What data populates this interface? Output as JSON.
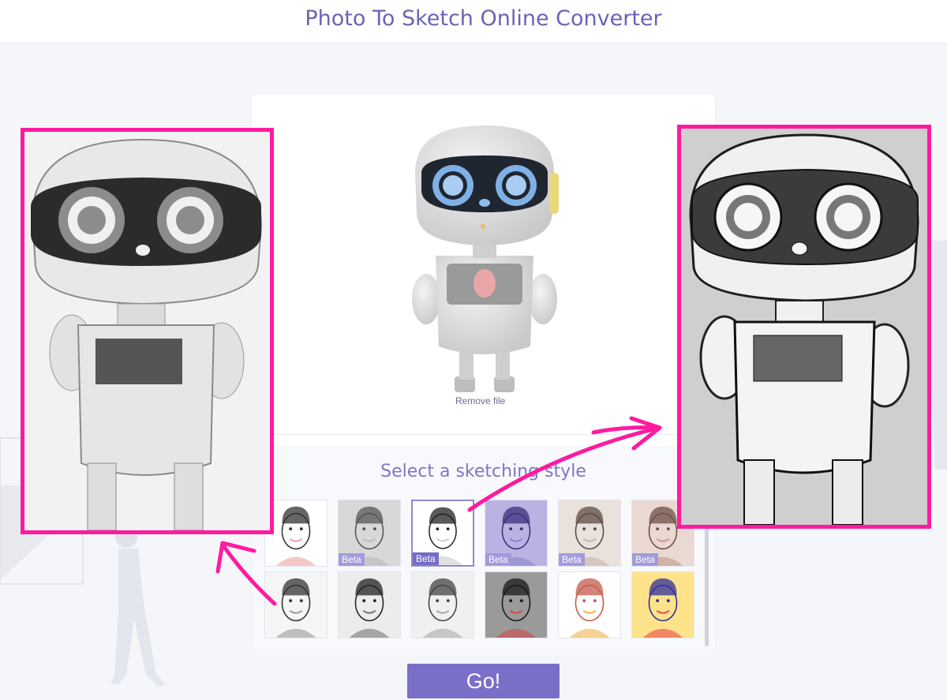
{
  "header": {
    "title": "Photo To Sketch Online Converter"
  },
  "upload": {
    "remove_file_label": "Remove file"
  },
  "styles": {
    "heading": "Select a sketching style",
    "beta_label": "Beta",
    "items": [
      {
        "beta": false,
        "selected": false
      },
      {
        "beta": true,
        "selected": false
      },
      {
        "beta": true,
        "selected": true
      },
      {
        "beta": true,
        "selected": false
      },
      {
        "beta": true,
        "selected": false
      },
      {
        "beta": true,
        "selected": false
      },
      {
        "beta": false,
        "selected": false
      },
      {
        "beta": false,
        "selected": false
      },
      {
        "beta": false,
        "selected": false
      },
      {
        "beta": false,
        "selected": false
      },
      {
        "beta": false,
        "selected": false
      },
      {
        "beta": false,
        "selected": false
      }
    ]
  },
  "actions": {
    "go_label": "Go!"
  },
  "colors": {
    "accent": "#7a6fc8",
    "title": "#6b63b5",
    "annotation": "#ff1aa0"
  }
}
